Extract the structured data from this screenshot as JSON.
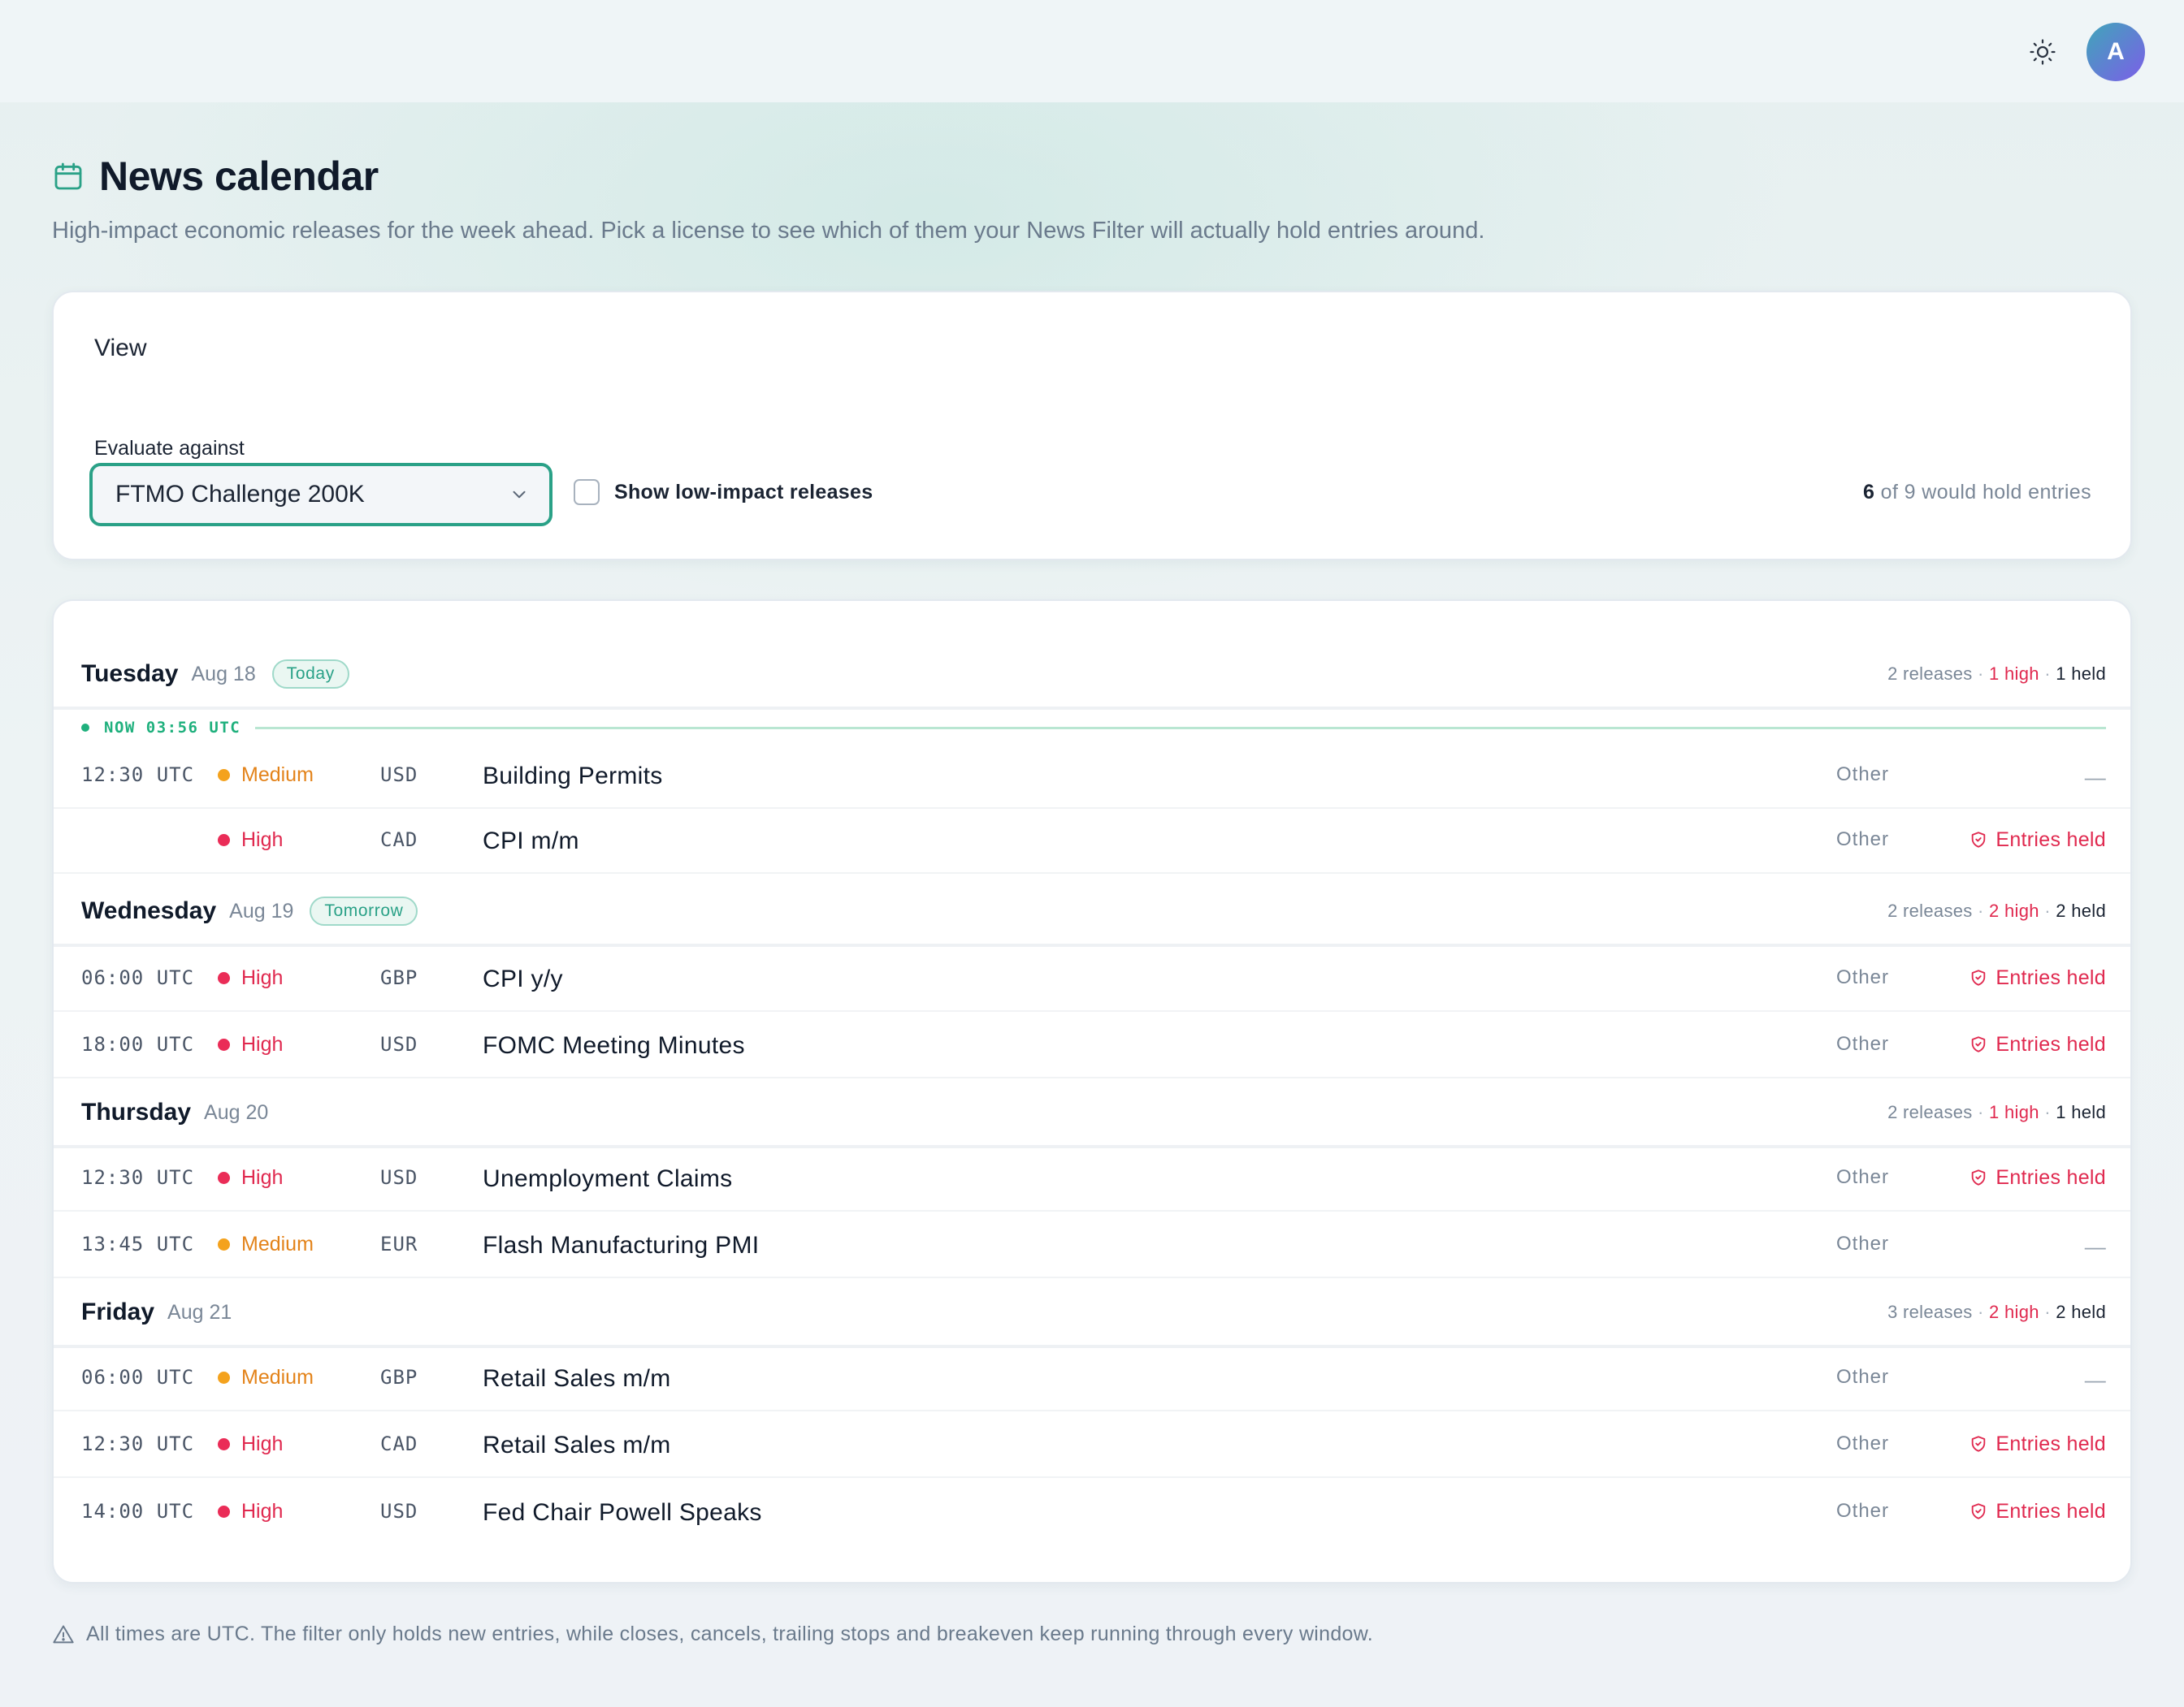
{
  "header": {
    "avatar_initial": "A",
    "theme_icon": "sun-icon"
  },
  "page": {
    "title": "News calendar",
    "title_icon": "calendar-icon",
    "subtitle": "High-impact economic releases for the week ahead. Pick a license to see which of them your News Filter will actually hold entries around."
  },
  "view": {
    "title": "View",
    "evaluate_label": "Evaluate against",
    "selected_license": "FTMO Challenge 200K",
    "show_low_impact_label": "Show low-impact releases",
    "show_low_impact_checked": false,
    "hold_count": "6",
    "hold_total_text": "of 9 would hold entries"
  },
  "now_marker": "NOW 03:56 UTC",
  "days": [
    {
      "name": "Tuesday",
      "date": "Aug 18",
      "badge": "Today",
      "releases": "2 releases",
      "high": "1 high",
      "held": "1 held",
      "events": [
        {
          "time": "12:30 UTC",
          "impact": "Medium",
          "currency": "USD",
          "name": "Building Permits",
          "category": "Other",
          "status": "—"
        },
        {
          "time": "",
          "impact": "High",
          "currency": "CAD",
          "name": "CPI m/m",
          "category": "Other",
          "status": "Entries held"
        }
      ]
    },
    {
      "name": "Wednesday",
      "date": "Aug 19",
      "badge": "Tomorrow",
      "releases": "2 releases",
      "high": "2 high",
      "held": "2 held",
      "events": [
        {
          "time": "06:00 UTC",
          "impact": "High",
          "currency": "GBP",
          "name": "CPI y/y",
          "category": "Other",
          "status": "Entries held"
        },
        {
          "time": "18:00 UTC",
          "impact": "High",
          "currency": "USD",
          "name": "FOMC Meeting Minutes",
          "category": "Other",
          "status": "Entries held"
        }
      ]
    },
    {
      "name": "Thursday",
      "date": "Aug 20",
      "badge": "",
      "releases": "2 releases",
      "high": "1 high",
      "held": "1 held",
      "events": [
        {
          "time": "12:30 UTC",
          "impact": "High",
          "currency": "USD",
          "name": "Unemployment Claims",
          "category": "Other",
          "status": "Entries held"
        },
        {
          "time": "13:45 UTC",
          "impact": "Medium",
          "currency": "EUR",
          "name": "Flash Manufacturing PMI",
          "category": "Other",
          "status": "—"
        }
      ]
    },
    {
      "name": "Friday",
      "date": "Aug 21",
      "badge": "",
      "releases": "3 releases",
      "high": "2 high",
      "held": "2 held",
      "events": [
        {
          "time": "06:00 UTC",
          "impact": "Medium",
          "currency": "GBP",
          "name": "Retail Sales m/m",
          "category": "Other",
          "status": "—"
        },
        {
          "time": "12:30 UTC",
          "impact": "High",
          "currency": "CAD",
          "name": "Retail Sales m/m",
          "category": "Other",
          "status": "Entries held"
        },
        {
          "time": "14:00 UTC",
          "impact": "High",
          "currency": "USD",
          "name": "Fed Chair Powell Speaks",
          "category": "Other",
          "status": "Entries held"
        }
      ]
    }
  ],
  "footer": {
    "note": "All times are UTC. The filter only holds new entries, while closes, cancels, trailing stops and breakeven keep running through every window."
  },
  "colors": {
    "accent": "#2aa187",
    "high": "#e0294f",
    "medium": "#e3831a",
    "now": "#1fb07d"
  }
}
